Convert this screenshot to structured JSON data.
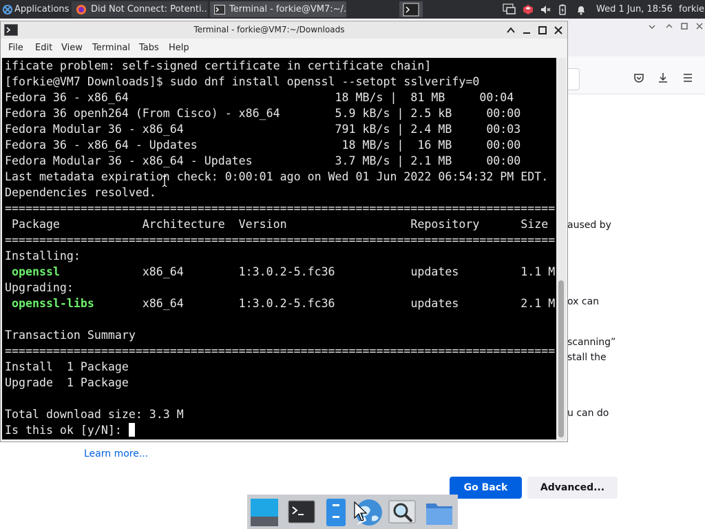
{
  "top_panel": {
    "applications_label": "Applications",
    "tasks": [
      {
        "label": "Did Not Connect: Potenti..."
      },
      {
        "label": "Terminal - forkie@VM7:~/..."
      }
    ],
    "clock": "Wed  1 Jun, 18:56",
    "user": "forkie"
  },
  "terminal": {
    "title": "Terminal - forkie@VM7:~/Downloads",
    "menu": [
      "File",
      "Edit",
      "View",
      "Terminal",
      "Tabs",
      "Help"
    ],
    "lines": [
      "ificate problem: self-signed certificate in certificate chain]",
      "[forkie@VM7 Downloads]$ sudo dnf install openssl --setopt sslverify=0",
      "Fedora 36 - x86_64                              18 MB/s |  81 MB     00:04",
      "Fedora 36 openh264 (From Cisco) - x86_64        5.9 kB/s | 2.5 kB     00:00",
      "Fedora Modular 36 - x86_64                      791 kB/s | 2.4 MB     00:03",
      "Fedora 36 - x86_64 - Updates                     18 MB/s |  16 MB     00:00",
      "Fedora Modular 36 - x86_64 - Updates            3.7 MB/s | 2.1 MB     00:00",
      "Last metadata expiration check: 0:00:01 ago on Wed 01 Jun 2022 06:54:32 PM EDT.",
      "Dependencies resolved.",
      "================================================================================",
      " Package            Architecture  Version                  Repository      Size",
      "================================================================================",
      "Installing:",
      "",
      "Upgrading:",
      "",
      "",
      "Transaction Summary",
      "================================================================================",
      "Install  1 Package",
      "Upgrade  1 Package",
      "",
      "Total download size: 3.3 M",
      "Is this ok [y/N]: "
    ],
    "package_rows": [
      {
        "name": "openssl",
        "rest": "            x86_64        1:3.0.2-5.fc36           updates         1.1 M"
      },
      {
        "name": "openssl-libs",
        "rest": "       x86_64        1:3.0.2-5.fc36           updates         2.1 M"
      }
    ]
  },
  "browser_bg": {
    "fragments": [
      "aused by",
      "ox can",
      "scanning”",
      "stall the",
      "u can do"
    ],
    "learn_more": "Learn more...",
    "go_back": "Go Back",
    "advanced": "Advanced..."
  }
}
